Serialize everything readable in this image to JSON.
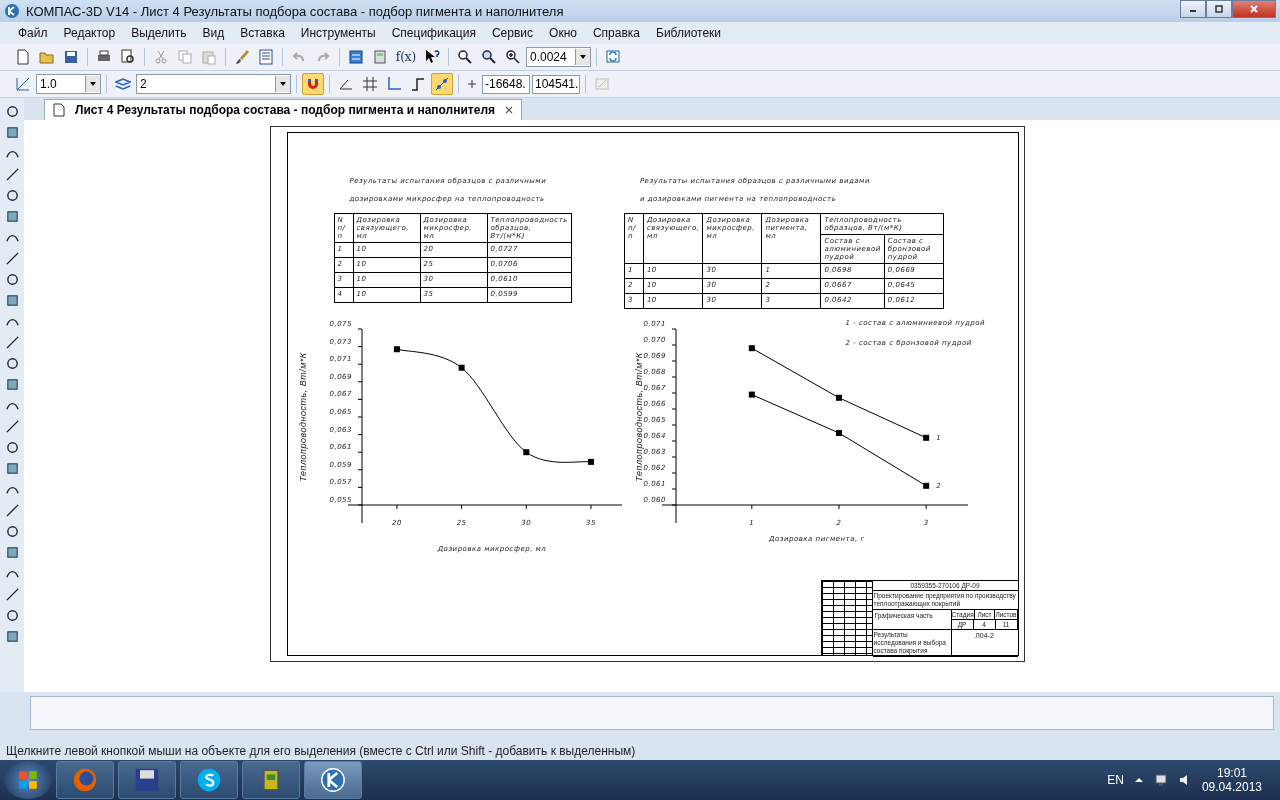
{
  "window": {
    "title": "КОМПАС-3D V14 - Лист 4 Результаты подбора состава - подбор пигмента и наполнителя"
  },
  "menu": [
    "Файл",
    "Редактор",
    "Выделить",
    "Вид",
    "Вставка",
    "Инструменты",
    "Спецификация",
    "Сервис",
    "Окно",
    "Справка",
    "Библиотеки"
  ],
  "toolbar": {
    "function_label": "f(x)",
    "zoom": "0.0024",
    "line_step": "1.0",
    "layer": "2",
    "x_coord": "-16648.",
    "y_coord": "104541.",
    "snap_on": true,
    "magnet_on": true
  },
  "document_tab": {
    "title": "Лист 4 Результаты подбора состава - подбор пигмента и наполнителя",
    "selected": true
  },
  "sheet": {
    "table_1": {
      "caption": [
        "Результаты испытания образцов с различными",
        "дозировками микросфер на теплопроводность"
      ],
      "columns": [
        "N п/п",
        "Дозировка связующего, мл",
        "Дозировка микросфер, мл",
        "Теплопроводность образцов, Вт/(м*К)"
      ],
      "rows": [
        [
          "1",
          "10",
          "20",
          "0,0727"
        ],
        [
          "2",
          "10",
          "25",
          "0,0706"
        ],
        [
          "3",
          "10",
          "30",
          "0,0610"
        ],
        [
          "4",
          "10",
          "35",
          "0,0599"
        ]
      ]
    },
    "table_2": {
      "caption": [
        "Результаты испытания образцов с различными видами",
        "и дозировками пигмента  на теплопроводность"
      ],
      "columns": [
        "N п/п",
        "Дозировка связующего, мл",
        "Дозировка микросфер, мл",
        "Дозировка пигмента, мл"
      ],
      "group_header": "Теплопроводность образцов, Вт/(м*К)",
      "subcolumns": [
        "Состав с алюминиевой пудрой",
        "Состав с бронзовой пудрой"
      ],
      "rows": [
        [
          "1",
          "10",
          "30",
          "1",
          "0,0698",
          "0,0669"
        ],
        [
          "2",
          "10",
          "30",
          "2",
          "0,0667",
          "0,0645"
        ],
        [
          "3",
          "10",
          "30",
          "3",
          "0,0642",
          "0,0612"
        ]
      ]
    },
    "chart_1": {
      "chart_data": {
        "type": "line",
        "xlabel": "Дозировка микросфер, мл",
        "ylabel": "Теплопроводность, Вт/м*К",
        "x": [
          20,
          25,
          30,
          35
        ],
        "series": [
          {
            "color": "#000000",
            "marker": "square",
            "values": [
              0.0727,
              0.0706,
              0.061,
              0.0599
            ]
          }
        ],
        "xlim": [
          17.3,
          37.4
        ],
        "ylim": [
          0.055,
          0.075
        ],
        "xticks": [
          {
            "value": 20,
            "label": "20"
          },
          {
            "value": 25,
            "label": "25"
          },
          {
            "value": 30,
            "label": "30"
          },
          {
            "value": 35,
            "label": "35"
          }
        ],
        "yticks": [
          {
            "value": 0.075,
            "label": "0,075"
          },
          {
            "value": 0.073,
            "label": "0,073"
          },
          {
            "value": 0.071,
            "label": "0,071"
          },
          {
            "value": 0.069,
            "label": "0,069"
          },
          {
            "value": 0.067,
            "label": "0,067"
          },
          {
            "value": 0.065,
            "label": "0,065"
          },
          {
            "value": 0.063,
            "label": "0,063"
          },
          {
            "value": 0.061,
            "label": "0,061"
          },
          {
            "value": 0.059,
            "label": "0,059"
          },
          {
            "value": 0.057,
            "label": "0,057"
          },
          {
            "value": 0.055,
            "label": "0,055"
          }
        ]
      }
    },
    "chart_2": {
      "legend": [
        "1 - состав с алюминиевой пудрой",
        "2 - состав с бронзовой пудрой"
      ],
      "chart_data": {
        "type": "line",
        "xlabel": "Дозировка пигмента, г",
        "ylabel": "Теплопроводность, Вт/м*К",
        "x": [
          1,
          2,
          3
        ],
        "series": [
          {
            "name": "1",
            "color": "#000000",
            "marker": "square",
            "values": [
              0.0698,
              0.0667,
              0.0642
            ]
          },
          {
            "name": "2",
            "color": "#000000",
            "marker": "square",
            "values": [
              0.0669,
              0.0645,
              0.0612
            ]
          }
        ],
        "xlim": [
          0.13,
          3.48
        ],
        "ylim": [
          0.06,
          0.071
        ],
        "xticks": [
          {
            "value": 1,
            "label": "1"
          },
          {
            "value": 2,
            "label": "2"
          },
          {
            "value": 3,
            "label": "3"
          }
        ],
        "yticks": [
          {
            "value": 0.071,
            "label": "0,071"
          },
          {
            "value": 0.07,
            "label": "0,070"
          },
          {
            "value": 0.069,
            "label": "0,069"
          },
          {
            "value": 0.068,
            "label": "0,068"
          },
          {
            "value": 0.067,
            "label": "0,067"
          },
          {
            "value": 0.066,
            "label": "0,066"
          },
          {
            "value": 0.065,
            "label": "0,065"
          },
          {
            "value": 0.064,
            "label": "0,064"
          },
          {
            "value": 0.063,
            "label": "0,063"
          },
          {
            "value": 0.062,
            "label": "0,062"
          },
          {
            "value": 0.061,
            "label": "0,061"
          },
          {
            "value": 0.06,
            "label": "0,060"
          }
        ]
      }
    },
    "title_block": {
      "code": "0359355-270106 ДР-09",
      "subject": "Проектирование предприятия по производству теплоотражающих покрытий",
      "part": "Графическая часть",
      "stage_labels": [
        "Стадия",
        "Лист",
        "Листов"
      ],
      "stage_values": [
        "ДР",
        "4",
        "11"
      ],
      "sheet_title": "Результаты исследования и выбора состава покрытия",
      "sheet_code": "Л04-2"
    }
  },
  "status_bar": "Щелкните левой кнопкой мыши на объекте для его выделения (вместе с Ctrl или Shift - добавить к выделенным)",
  "taskbar": {
    "language": "EN",
    "time": "19:01",
    "date": "09.04.2013"
  }
}
